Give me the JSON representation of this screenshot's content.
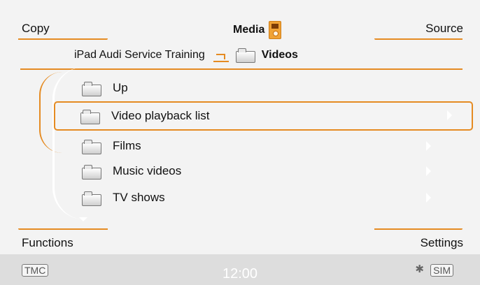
{
  "header": {
    "left": "Copy",
    "title": "Media",
    "right": "Source"
  },
  "breadcrumb": {
    "source": "iPad Audi Service Training",
    "folder": "Videos"
  },
  "list": [
    {
      "label": "Up",
      "icon": "folder-up-icon"
    },
    {
      "label": "Video playback list",
      "icon": "folder-icon",
      "selected": true
    },
    {
      "label": "Films",
      "icon": "folder-icon"
    },
    {
      "label": "Music videos",
      "icon": "folder-icon"
    },
    {
      "label": "TV shows",
      "icon": "folder-icon"
    }
  ],
  "footer": {
    "left": "Functions",
    "right": "Settings"
  },
  "status": {
    "left": "TMC",
    "time": "12:00",
    "right": "SIM"
  },
  "colors": {
    "accent": "#e58b22",
    "background": "#f4f4f4"
  }
}
